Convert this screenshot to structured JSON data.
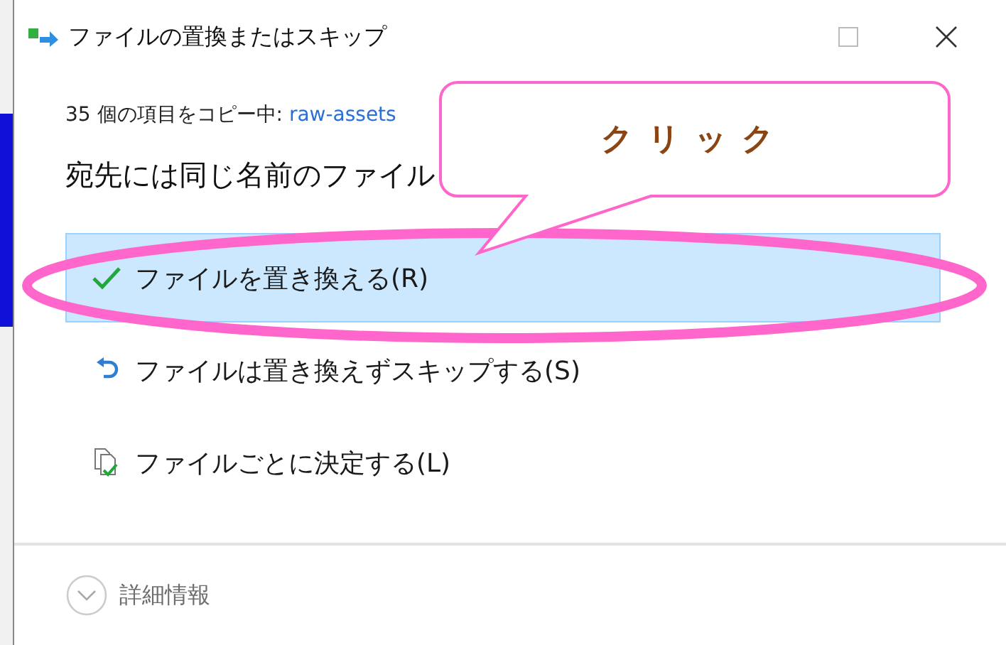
{
  "window": {
    "title": "ファイルの置換またはスキップ"
  },
  "status": {
    "text": "35 個の項目をコピー中: ",
    "source": "raw-assets"
  },
  "heading": "宛先には同じ名前のファイル",
  "options": [
    {
      "kind": "replace",
      "label": "ファイルを置き換える(R)",
      "selected": true
    },
    {
      "kind": "skip",
      "label": "ファイルは置き換えずスキップする(S)",
      "selected": false
    },
    {
      "kind": "compare",
      "label": "ファイルごとに決定する(L)",
      "selected": false
    }
  ],
  "details": {
    "label": "詳細情報",
    "expanded": false
  },
  "annotation": {
    "text": "クリック"
  }
}
